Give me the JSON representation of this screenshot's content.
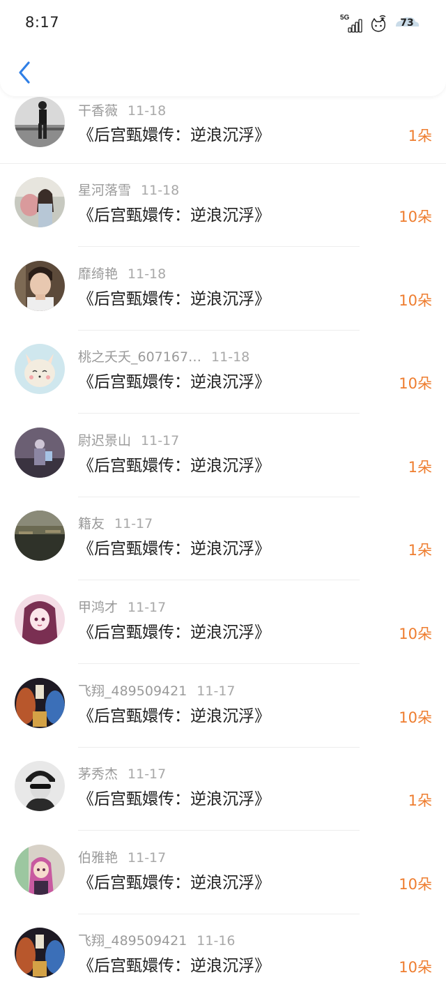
{
  "status_bar": {
    "time": "8:17",
    "network": "5G",
    "battery": "73"
  },
  "colors": {
    "accent": "#ee7d2f",
    "back": "#2f7fe6"
  },
  "icons": {
    "back": "chevron-left-icon",
    "signal": "signal-icon",
    "wifi": "wifi-icon",
    "battery": "battery-icon"
  },
  "records": [
    {
      "name": "干香薇",
      "date": "11-18",
      "title": "《后宫甄嬛传：逆浪沉浮》",
      "amount": "1朵",
      "avatar": "avatar-bw-person"
    },
    {
      "name": "星河落雪",
      "date": "11-18",
      "title": "《后宫甄嬛传：逆浪沉浮》",
      "amount": "10朵",
      "avatar": "avatar-girl-outdoor"
    },
    {
      "name": "靡绮艳",
      "date": "11-18",
      "title": "《后宫甄嬛传：逆浪沉浮》",
      "amount": "10朵",
      "avatar": "avatar-young-man"
    },
    {
      "name": "桃之夭夭_607167…",
      "date": "11-18",
      "title": "《后宫甄嬛传：逆浪沉浮》",
      "amount": "10朵",
      "avatar": "avatar-cat-cartoon"
    },
    {
      "name": "尉迟景山",
      "date": "11-17",
      "title": "《后宫甄嬛传：逆浪沉浮》",
      "amount": "1朵",
      "avatar": "avatar-dark-figure"
    },
    {
      "name": "籍友",
      "date": "11-17",
      "title": "《后宫甄嬛传：逆浪沉浮》",
      "amount": "1朵",
      "avatar": "avatar-landscape"
    },
    {
      "name": "甲鸿才",
      "date": "11-17",
      "title": "《后宫甄嬛传：逆浪沉浮》",
      "amount": "10朵",
      "avatar": "avatar-anime-girl"
    },
    {
      "name": "飞翔_489509421",
      "date": "11-17",
      "title": "《后宫甄嬛传：逆浪沉浮》",
      "amount": "10朵",
      "avatar": "avatar-poster-art"
    },
    {
      "name": "茅秀杰",
      "date": "11-17",
      "title": "《后宫甄嬛传：逆浪沉浮》",
      "amount": "1朵",
      "avatar": "avatar-sunglasses-bw"
    },
    {
      "name": "伯雅艳",
      "date": "11-17",
      "title": "《后宫甄嬛传：逆浪沉浮》",
      "amount": "10朵",
      "avatar": "avatar-anime-colorful"
    },
    {
      "name": "飞翔_489509421",
      "date": "11-16",
      "title": "《后宫甄嬛传：逆浪沉浮》",
      "amount": "10朵",
      "avatar": "avatar-poster-art"
    }
  ]
}
